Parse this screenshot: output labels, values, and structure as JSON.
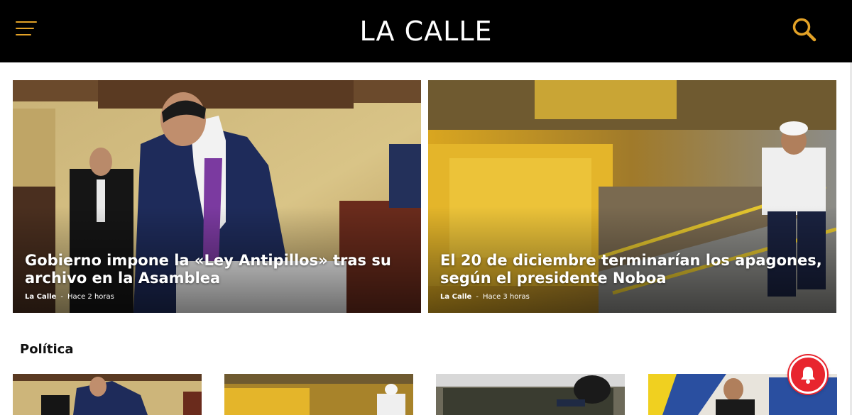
{
  "header": {
    "logo_text": "LA CALLE",
    "menu_icon": "hamburger-menu-icon",
    "search_icon": "search-icon",
    "accent_color": "#e3a227"
  },
  "hero": [
    {
      "title": "Gobierno impone la «Ley Antipillos» tras su archivo en la Asamblea",
      "source": "La Calle",
      "separator": "-",
      "time": "Hace 2 horas"
    },
    {
      "title": "El 20 de diciembre terminarían los apagones, según el presidente Noboa",
      "source": "La Calle",
      "separator": "-",
      "time": "Hace 3 horas"
    }
  ],
  "section": {
    "title": "Política"
  },
  "notification": {
    "icon": "bell-icon",
    "color": "#e8252e"
  }
}
